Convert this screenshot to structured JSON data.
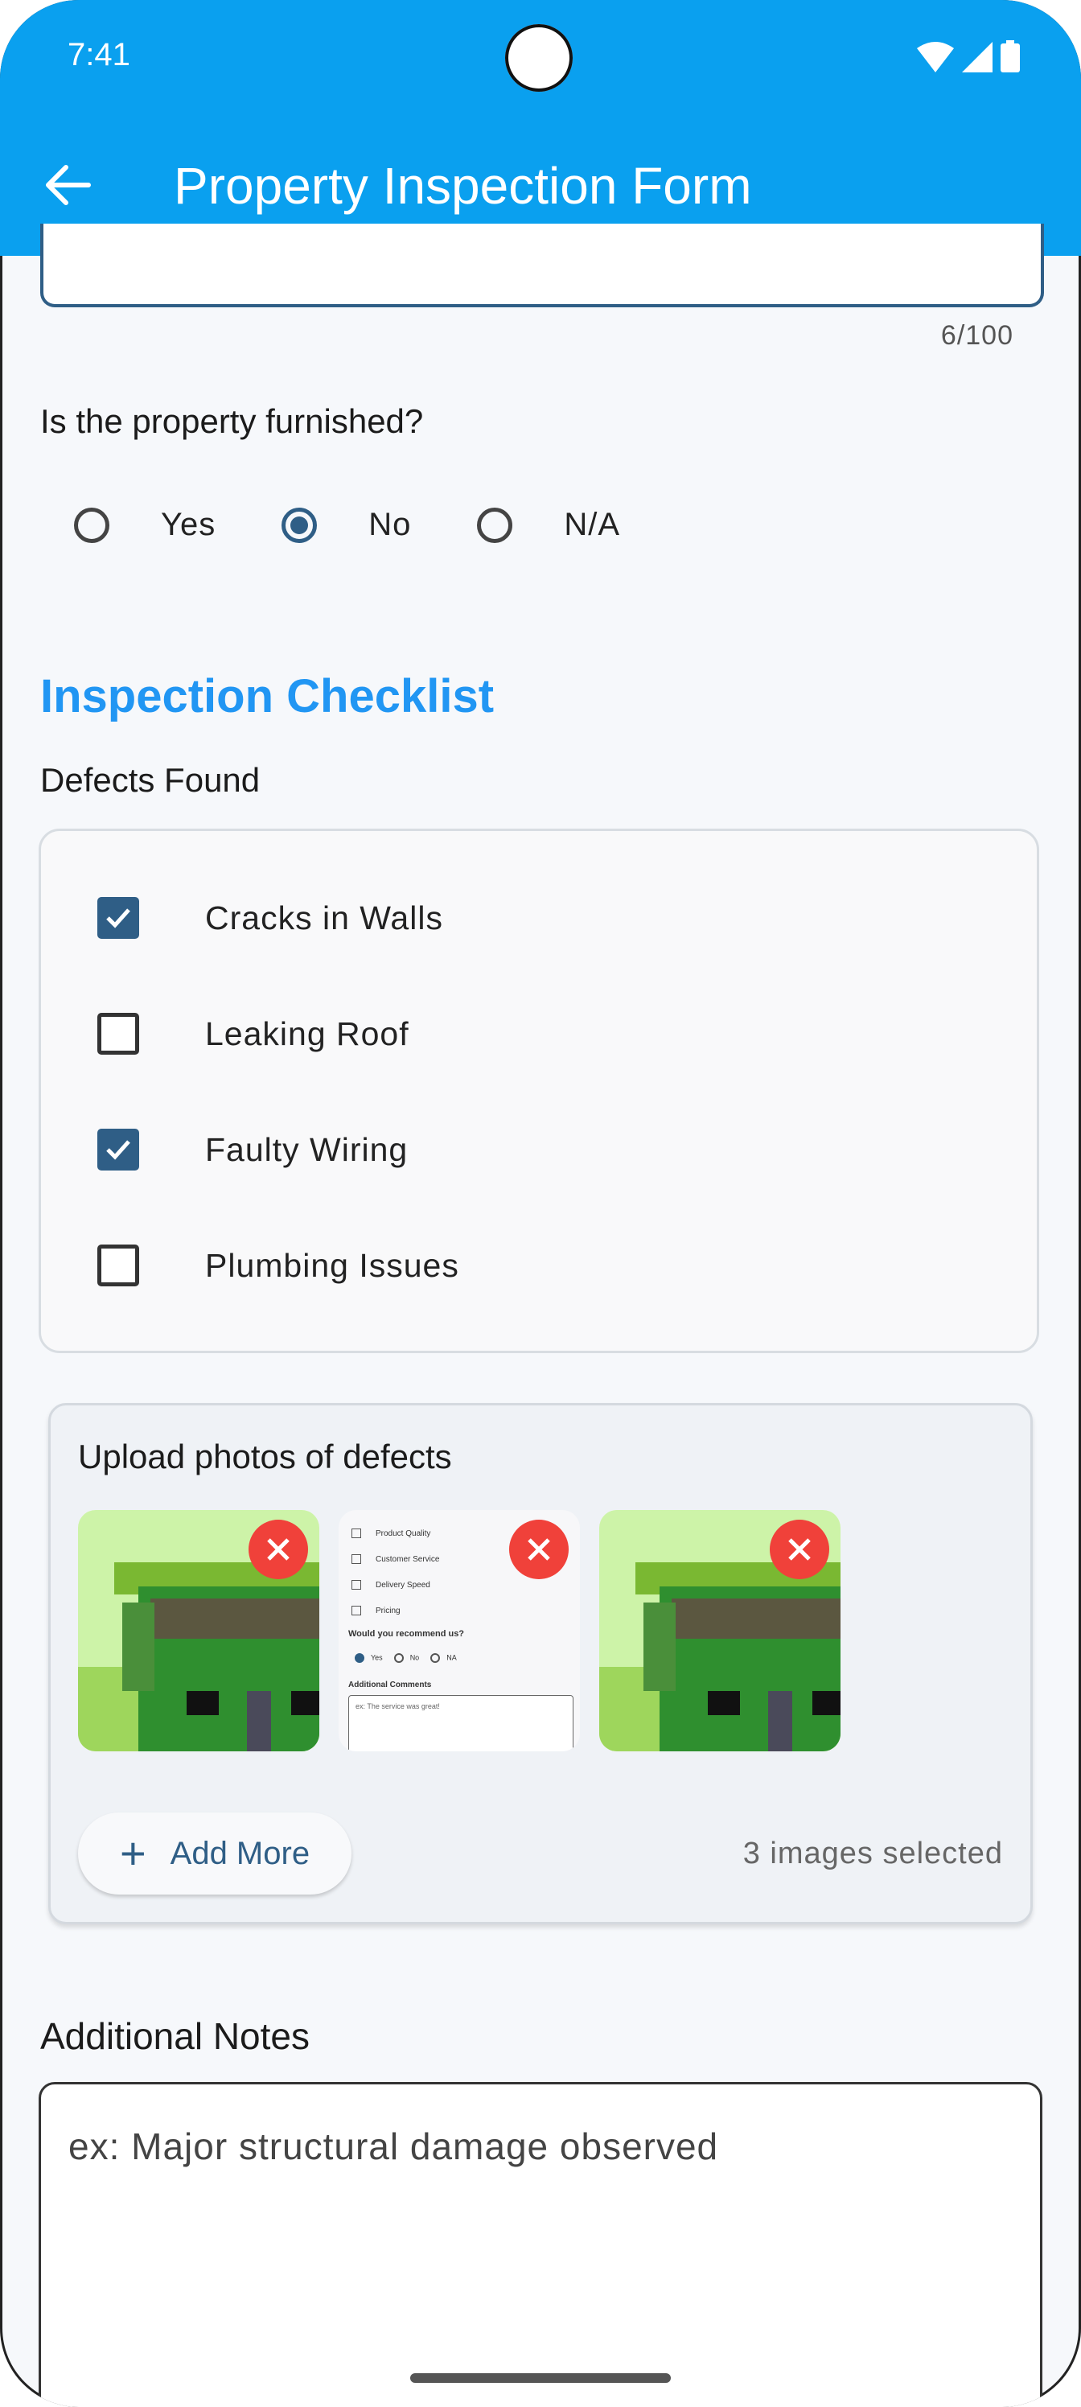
{
  "status_bar": {
    "time": "7:41"
  },
  "app_bar": {
    "title": "Property Inspection Form",
    "back_icon": "arrow-back-icon"
  },
  "previous_field": {
    "counter": "6/100"
  },
  "furnished": {
    "question": "Is the property furnished?",
    "options": [
      "Yes",
      "No",
      "N/A"
    ],
    "selected": "No"
  },
  "checklist": {
    "section_title": "Inspection Checklist",
    "label": "Defects Found",
    "items": [
      {
        "label": "Cracks in Walls",
        "checked": true
      },
      {
        "label": "Leaking Roof",
        "checked": false
      },
      {
        "label": "Faulty Wiring",
        "checked": true
      },
      {
        "label": "Plumbing Issues",
        "checked": false
      }
    ]
  },
  "upload": {
    "title": "Upload photos of defects",
    "add_more_label": "Add More",
    "count_text": "3 images selected",
    "screenshot_thumb": {
      "items": [
        "Product Quality",
        "Customer Service",
        "Delivery Speed",
        "Pricing"
      ],
      "question": "Would you recommend us?",
      "options": [
        "Yes",
        "No",
        "NA"
      ],
      "comments_label": "Additional Comments",
      "comments_placeholder": "ex: The service was great!"
    }
  },
  "notes": {
    "label": "Additional Notes",
    "placeholder": "ex: Major structural damage observed"
  },
  "colors": {
    "app_bar": "#0aa0ef",
    "accent": "#2196f3",
    "control": "#2f5e86",
    "remove": "#f0413a"
  }
}
